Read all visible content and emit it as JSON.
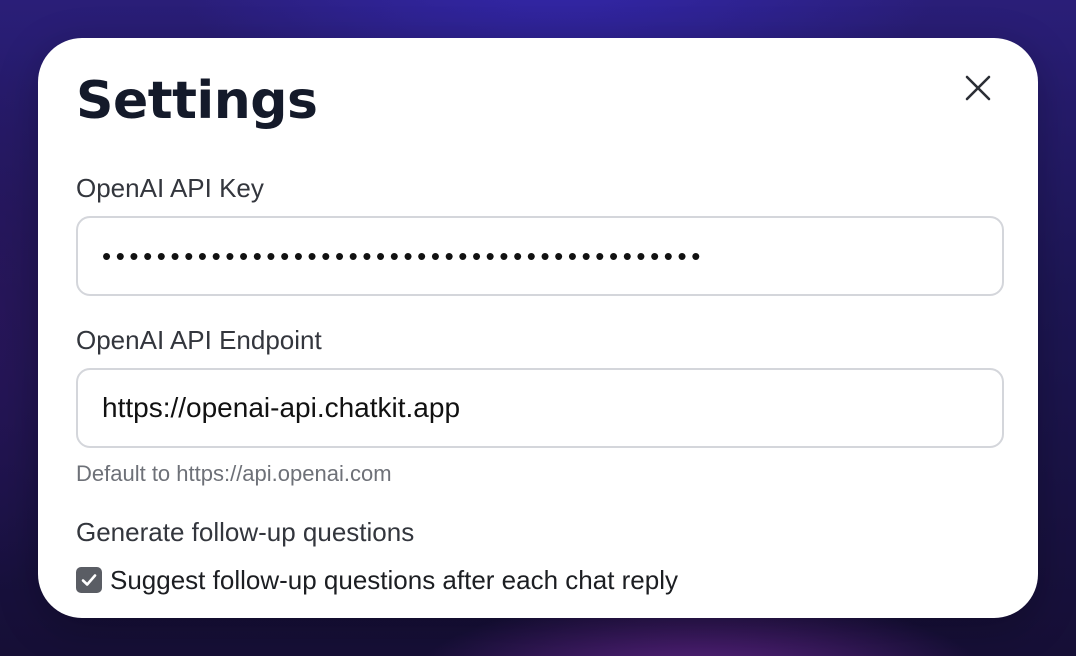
{
  "settings": {
    "title": "Settings",
    "close_icon": "close-icon",
    "api_key": {
      "label": "OpenAI API Key",
      "value": "sk-xxxxxxxxxxxxxxxxxxxxxxxxxxxxxxxxxxxxxxxxx",
      "masked": true
    },
    "api_endpoint": {
      "label": "OpenAI API Endpoint",
      "value": "https://openai-api.chatkit.app",
      "hint": "Default to https://api.openai.com"
    },
    "follow_up": {
      "section_label": "Generate follow-up questions",
      "checkbox_label": "Suggest follow-up questions after each chat reply",
      "checked": true,
      "check_color": "#5a5d64"
    }
  }
}
